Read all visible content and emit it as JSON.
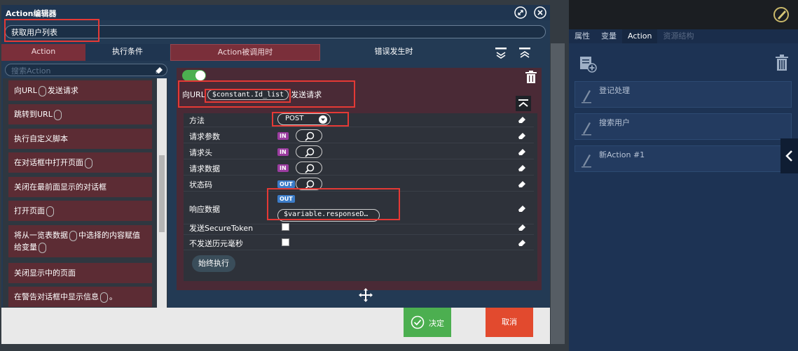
{
  "dialog": {
    "title": "Action编辑器",
    "name_value": "获取用户列表",
    "left_tabs": [
      "Action",
      "执行条件"
    ],
    "search_placeholder": "搜索Action",
    "list_items": [
      {
        "parts": [
          "向URL",
          "发送请求"
        ]
      },
      {
        "parts": [
          "跳转到URL",
          ""
        ]
      },
      {
        "parts": [
          "执行自定义脚本"
        ]
      },
      {
        "parts": [
          "在对话框中打开页面",
          ""
        ]
      },
      {
        "parts": [
          "关闭在最前面显示的对话框"
        ]
      },
      {
        "parts": [
          "打开页面",
          ""
        ]
      },
      {
        "parts": [
          "将从一览表数据",
          "中选择的内容赋值给变量",
          ""
        ]
      },
      {
        "parts": [
          "关闭显示中的页面"
        ]
      },
      {
        "parts": [
          "在警告对话框中显示信息",
          "。"
        ]
      }
    ],
    "middle_tabs": [
      "Action被调用时",
      "错误发生时"
    ],
    "url_prefix": "向URL",
    "url_constant": "$constant.Id_list",
    "url_suffix": "发送请求",
    "params": [
      {
        "label": "方法",
        "value": "POST"
      },
      {
        "label": "请求参数",
        "badge": "IN"
      },
      {
        "label": "请求头",
        "badge": "IN"
      },
      {
        "label": "请求数据",
        "badge": "IN"
      },
      {
        "label": "状态码",
        "badge": "OUT"
      },
      {
        "label": "响应数据",
        "badge": "OUT",
        "value": "$variable.responseD…"
      },
      {
        "label": "发送SecureToken"
      },
      {
        "label": "不发送历元毫秒"
      }
    ],
    "always_execute": "始终执行",
    "ok_label": "决定",
    "cancel_label": "取消"
  },
  "right_panel": {
    "tabs": [
      "属性",
      "变量",
      "Action",
      "资源结构"
    ],
    "actions": [
      "登记处理",
      "搜索用户",
      "新Action #1"
    ]
  },
  "colors": {
    "accent_maroon": "#7a2f3a",
    "highlight_red": "#e53935",
    "toggle_green": "#4caf50",
    "cancel_red": "#e24a2e"
  }
}
